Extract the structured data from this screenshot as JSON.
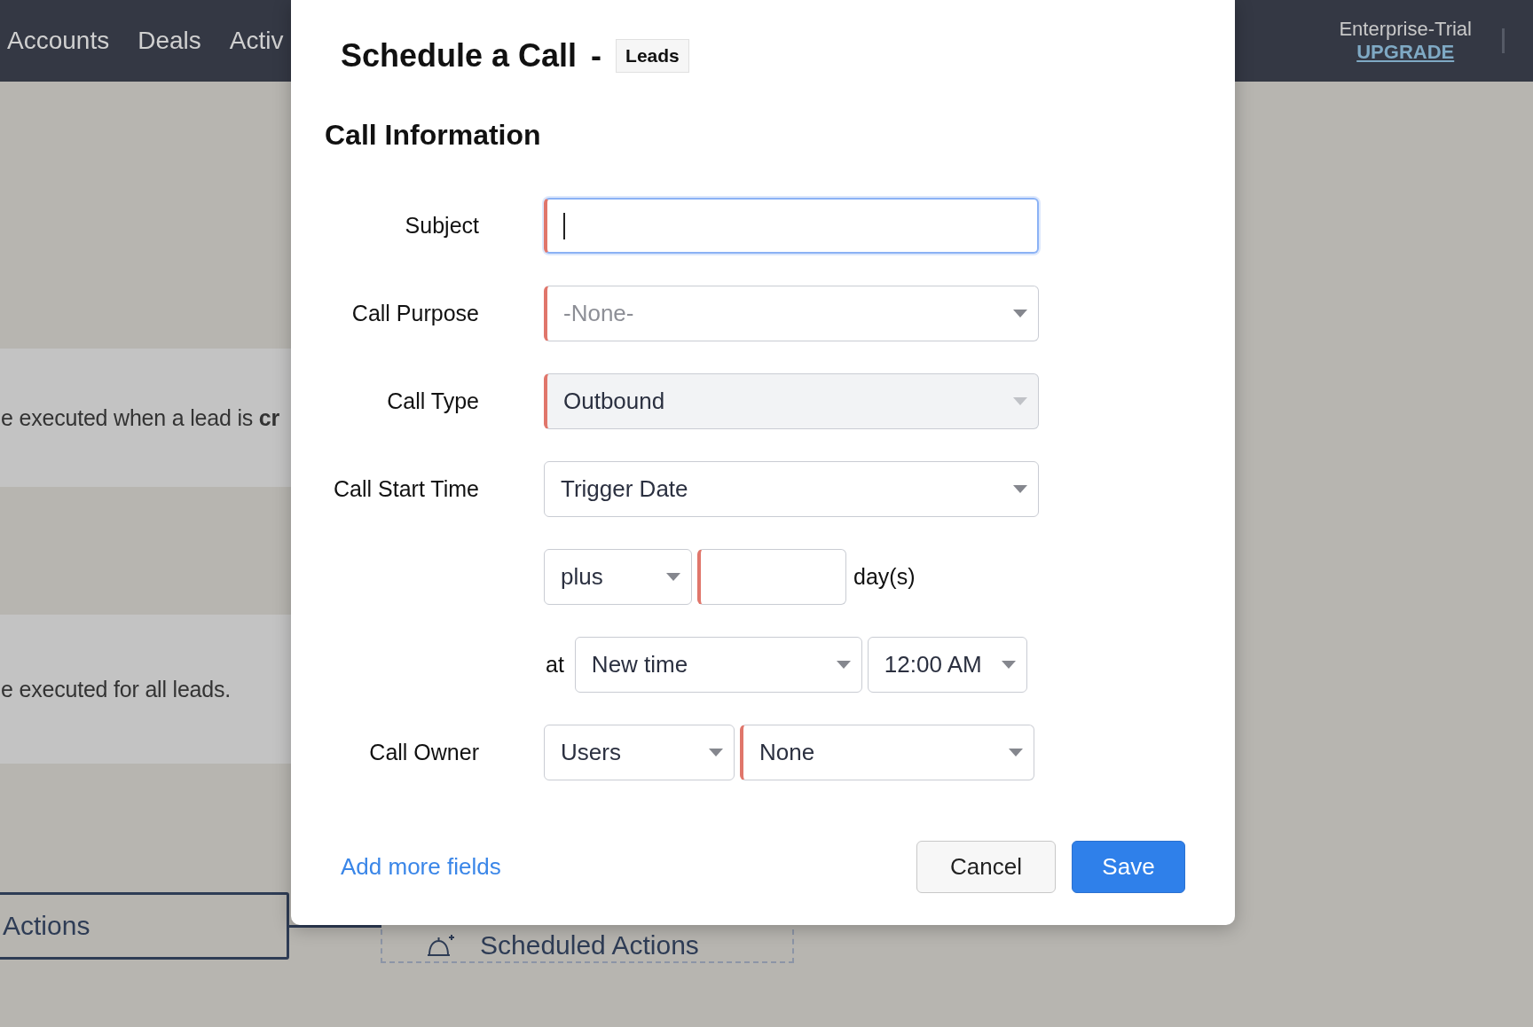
{
  "top_nav": {
    "items": [
      "Accounts",
      "Deals",
      "Activ"
    ],
    "plan": "Enterprise-Trial",
    "upgrade": "UPGRADE"
  },
  "background": {
    "rule_texts": [
      "e executed when a lead is **cr**",
      "e executed for all leads."
    ],
    "flow": [
      {
        "label": "Actions",
        "kind": "solid"
      },
      {
        "label": "Scheduled Actions",
        "kind": "dashed"
      }
    ]
  },
  "dialog": {
    "title": "Schedule a Call",
    "separator": "-",
    "module_tag": "Leads",
    "section_title": "Call Information",
    "rows": [
      {
        "label": "Subject",
        "kind": "single",
        "controls": [
          {
            "kind": "input",
            "mandatory": true,
            "focused": true,
            "disabled": false
          }
        ]
      },
      {
        "label": "Call Purpose",
        "kind": "single",
        "controls": [
          {
            "kind": "select",
            "value": "-None-",
            "muted": true,
            "mandatory": true,
            "disabled": false
          }
        ]
      },
      {
        "label": "Call Type",
        "kind": "single",
        "controls": [
          {
            "kind": "select",
            "value": "Outbound",
            "muted": false,
            "mandatory": true,
            "disabled": true
          }
        ]
      },
      {
        "label": "Call Start Time",
        "kind": "single",
        "controls": [
          {
            "kind": "select",
            "value": "Trigger Date",
            "muted": false,
            "mandatory": false,
            "disabled": false
          }
        ]
      },
      {
        "kind": "offset",
        "controls": [
          {
            "kind": "select",
            "value": "plus",
            "muted": false,
            "mandatory": false,
            "disabled": false
          },
          {
            "kind": "input",
            "mandatory": true,
            "focused": false,
            "disabled": false
          },
          {
            "kind": "text",
            "text": "day(s)"
          }
        ]
      },
      {
        "kind": "time",
        "controls": [
          {
            "kind": "text",
            "text": "at"
          },
          {
            "kind": "select",
            "value": "New time",
            "muted": false,
            "mandatory": false,
            "disabled": false
          },
          {
            "kind": "select",
            "value": "12:00 AM",
            "muted": false,
            "mandatory": false,
            "disabled": false
          }
        ]
      },
      {
        "label": "Call Owner",
        "kind": "owner",
        "controls": [
          {
            "kind": "select",
            "value": "Users",
            "muted": false,
            "mandatory": false,
            "disabled": false
          },
          {
            "kind": "select",
            "value": "None",
            "muted": false,
            "mandatory": true,
            "disabled": false
          }
        ]
      }
    ],
    "add_more_link": "Add more fields",
    "buttons": [
      {
        "label": "Cancel",
        "kind": "secondary"
      },
      {
        "label": "Save",
        "kind": "primary"
      }
    ]
  }
}
